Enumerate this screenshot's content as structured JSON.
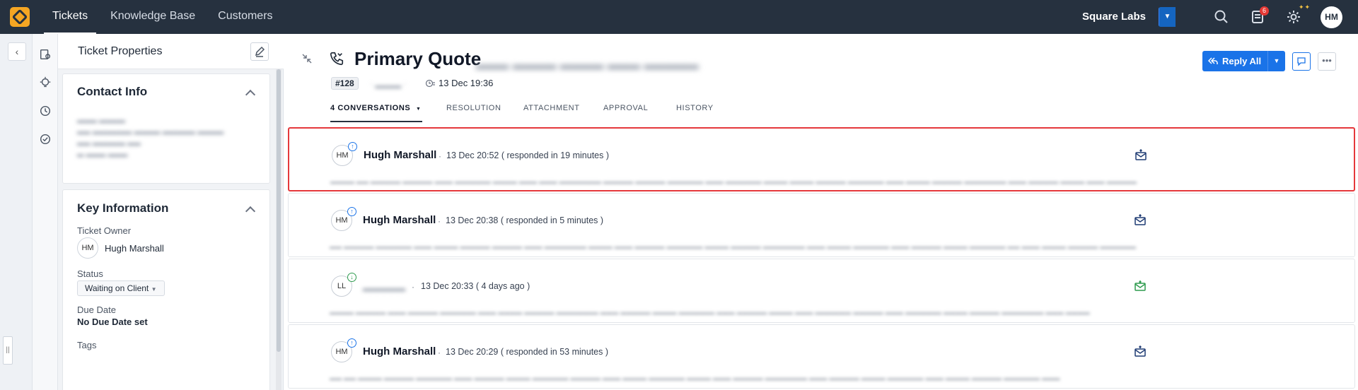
{
  "topbar": {
    "tabs": [
      {
        "label": "Tickets",
        "active": true
      },
      {
        "label": "Knowledge Base",
        "active": false
      },
      {
        "label": "Customers",
        "active": false
      }
    ],
    "org_name": "Square Labs",
    "add_label": "+",
    "notification_count": "6",
    "user_initials": "HM"
  },
  "panel": {
    "title": "Ticket Properties",
    "contact_info": {
      "title": "Contact Info"
    },
    "key_info": {
      "title": "Key Information",
      "owner_label": "Ticket Owner",
      "owner_initials": "HM",
      "owner_name": "Hugh Marshall",
      "status_label": "Status",
      "status_value": "Waiting on Client",
      "due_label": "Due Date",
      "due_value": "No Due Date set",
      "tags_label": "Tags"
    }
  },
  "ticket": {
    "subject": "Primary Quote",
    "id": "#128",
    "created": "13 Dec 19:36",
    "reply_all_label": "Reply All"
  },
  "tabs": [
    {
      "label": "4 CONVERSATIONS",
      "active": true
    },
    {
      "label": "RESOLUTION",
      "active": false
    },
    {
      "label": "ATTACHMENT",
      "active": false
    },
    {
      "label": "APPROVAL",
      "active": false
    },
    {
      "label": "HISTORY",
      "active": false
    }
  ],
  "conversations": [
    {
      "initials": "HM",
      "name": "Hugh Marshall",
      "time": "13 Dec 20:52 ( responded in 19 minutes )",
      "direction": "out",
      "highlighted": true
    },
    {
      "initials": "HM",
      "name": "Hugh Marshall",
      "time": "13 Dec 20:38 ( responded in 5 minutes )",
      "direction": "out",
      "highlighted": false
    },
    {
      "initials": "LL",
      "name": "",
      "time": "13 Dec 20:33 ( 4 days ago )",
      "direction": "in",
      "highlighted": false
    },
    {
      "initials": "HM",
      "name": "Hugh Marshall",
      "time": "13 Dec 20:29 ( responded in 53 minutes )",
      "direction": "out",
      "highlighted": false
    }
  ],
  "colors": {
    "topbar": "#26313f",
    "accent": "#1a73e8",
    "highlight": "#e5383b",
    "logo": "#f5a623"
  },
  "icons": {
    "logo": "logo-icon",
    "search": "search-icon",
    "notifications": "notifications-icon",
    "settings": "gear-icon",
    "phone": "phone-icon",
    "mail": "mail-icon"
  }
}
